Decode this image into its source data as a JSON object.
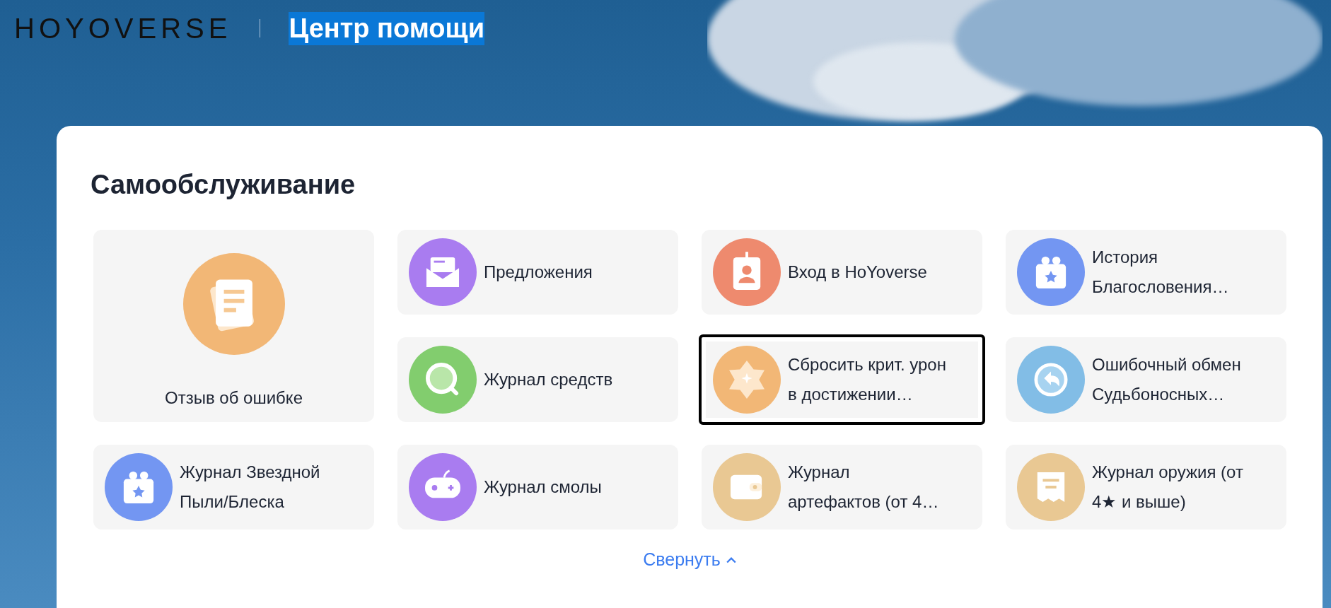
{
  "header": {
    "logo": "HOYOVERSE",
    "title": "Центр помощи",
    "title_highlighted": true
  },
  "panel": {
    "heading": "Самообслуживание",
    "tiles": [
      {
        "kind": "large",
        "label": "Отзыв об ошибке",
        "color": "#f2b776",
        "focused": false
      },
      {
        "kind": "small",
        "label": "Предложения",
        "color": "#a97cf0",
        "focused": false
      },
      {
        "kind": "small",
        "label": "Вход в HoYoverse",
        "color": "#ee8a6e",
        "focused": false
      },
      {
        "kind": "small",
        "label": "История\nБлагословения…",
        "color": "#7396f2",
        "focused": false
      },
      {
        "kind": "small",
        "label": "Журнал средств",
        "color": "#82cd6e",
        "focused": false
      },
      {
        "kind": "small",
        "label": "Сбросить крит. урон\nв достижении…",
        "color": "#f2b776",
        "focused": true
      },
      {
        "kind": "small",
        "label": "Ошибочный обмен\nСудьбоносных…",
        "color": "#82bde6",
        "focused": false
      },
      {
        "kind": "small",
        "label": "Журнал Звездной\nПыли/Блеска",
        "color": "#7396f2",
        "focused": false
      },
      {
        "kind": "small",
        "label": "Журнал смолы",
        "color": "#a97cf0",
        "focused": false
      },
      {
        "kind": "small",
        "label": "Журнал\nартефактов (от 4…",
        "color": "#e9c893",
        "focused": false
      },
      {
        "kind": "small",
        "label": "Журнал оружия (от\n4★ и выше)",
        "color": "#e9c893",
        "focused": false
      }
    ],
    "collapse_link": "Свернуть"
  }
}
